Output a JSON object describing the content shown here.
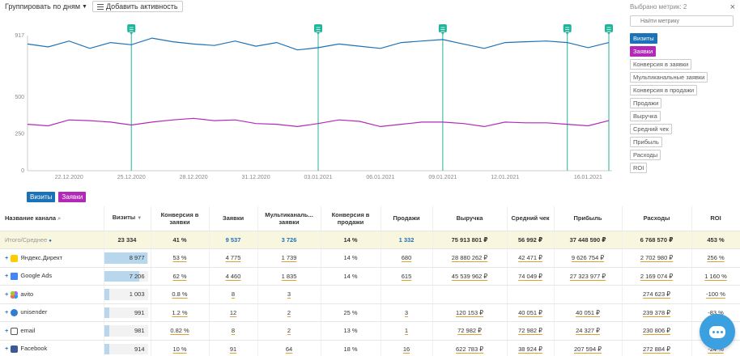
{
  "toolbar": {
    "group_label": "Группировать по дням",
    "add_activity_label": "Добавить активность"
  },
  "colors": {
    "visits": "#1c72b6",
    "requests": "#b229b7",
    "marker": "#1fb59a"
  },
  "chart_data": {
    "type": "line",
    "ylim": [
      0,
      917
    ],
    "yticks": [
      0,
      250,
      500,
      917
    ],
    "x_tick_labels": [
      "22.12.2020",
      "25.12.2020",
      "28.12.2020",
      "31.12.2020",
      "03.01.2021",
      "06.01.2021",
      "09.01.2021",
      "12.01.2021",
      "16.01.2021"
    ],
    "x_tick_index": [
      2,
      5,
      8,
      11,
      14,
      17,
      20,
      23,
      27
    ],
    "n_points": 29,
    "series": [
      {
        "name": "Визиты",
        "values": [
          860,
          840,
          880,
          830,
          870,
          855,
          900,
          875,
          860,
          850,
          880,
          845,
          870,
          820,
          835,
          860,
          845,
          830,
          870,
          880,
          890,
          860,
          830,
          870,
          875,
          880,
          870,
          835,
          870
        ]
      },
      {
        "name": "Заявки",
        "values": [
          315,
          305,
          345,
          340,
          330,
          310,
          330,
          345,
          355,
          340,
          345,
          320,
          315,
          300,
          320,
          345,
          335,
          300,
          315,
          330,
          330,
          320,
          300,
          330,
          325,
          325,
          315,
          305,
          340
        ]
      }
    ],
    "markers": [
      5,
      14,
      20,
      26,
      28
    ]
  },
  "legend": {
    "visits": "Визиты",
    "requests": "Заявки"
  },
  "metrics": {
    "selected_label": "Выбрано метрик: 2",
    "search_placeholder": "Найти метрику",
    "items": [
      "Визиты",
      "Заявки",
      "Конверсия в заявки",
      "Мультиканальные заявки",
      "Конверсия в продажи",
      "Продажи",
      "Выручка",
      "Средний чек",
      "Прибыль",
      "Расходы",
      "ROI"
    ]
  },
  "table": {
    "headers": [
      "Название канала",
      "Визиты",
      "Конверсия в заявки",
      "Заявки",
      "Мультиканаль... заявки",
      "Конверсия в продажи",
      "Продажи",
      "Выручка",
      "Средний чек",
      "Прибыль",
      "Расходы",
      "ROI"
    ],
    "summary": [
      "Итого/Среднее",
      "23 334",
      "41 %",
      "9 537",
      "3 726",
      "14 %",
      "1 332",
      "75 913 801 ₽",
      "56 992 ₽",
      "37 448 590 ₽",
      "6 768 570 ₽",
      "453 %"
    ],
    "rows": [
      {
        "name": "Яндекс.Директ",
        "visits": "8 977",
        "visits_share": 0.38,
        "conv": "53 %",
        "req": "4 775",
        "multi": "1 739",
        "conv_sales": "14 %",
        "sales": "680",
        "revenue": "28 880 262 ₽",
        "avg": "42 471 ₽",
        "profit": "9 626 754 ₽",
        "costs": "2 702 980 ₽",
        "roi": "256 %"
      },
      {
        "name": "Google Ads",
        "visits": "7 206",
        "visits_share": 0.31,
        "conv": "62 %",
        "req": "4 460",
        "multi": "1 835",
        "conv_sales": "14 %",
        "sales": "615",
        "revenue": "45 539 962 ₽",
        "avg": "74 049 ₽",
        "profit": "27 323 977 ₽",
        "costs": "2 169 074 ₽",
        "roi": "1 160 %"
      },
      {
        "name": "avito",
        "visits": "1 003",
        "visits_share": 0.04,
        "conv": "0.8 %",
        "req": "8",
        "multi": "3",
        "conv_sales": "",
        "sales": "",
        "revenue": "",
        "avg": "",
        "profit": "",
        "costs": "274 623 ₽",
        "roi": "-100 %"
      },
      {
        "name": "unisender",
        "visits": "991",
        "visits_share": 0.04,
        "conv": "1.2 %",
        "req": "12",
        "multi": "2",
        "conv_sales": "25 %",
        "sales": "3",
        "revenue": "120 153 ₽",
        "avg": "40 051 ₽",
        "profit": "40 051 ₽",
        "costs": "239 378 ₽",
        "roi": "-83 %"
      },
      {
        "name": "email",
        "visits": "981",
        "visits_share": 0.04,
        "conv": "0.82 %",
        "req": "8",
        "multi": "2",
        "conv_sales": "13 %",
        "sales": "1",
        "revenue": "72 982 ₽",
        "avg": "72 982 ₽",
        "profit": "24 327 ₽",
        "costs": "230 806 ₽",
        "roi": "-90 %"
      },
      {
        "name": "Facebook",
        "visits": "914",
        "visits_share": 0.04,
        "conv": "10 %",
        "req": "91",
        "multi": "64",
        "conv_sales": "18 %",
        "sales": "16",
        "revenue": "622 783 ₽",
        "avg": "38 924 ₽",
        "profit": "207 594 ₽",
        "costs": "272 884 ₽",
        "roi": "-24 %"
      }
    ]
  }
}
